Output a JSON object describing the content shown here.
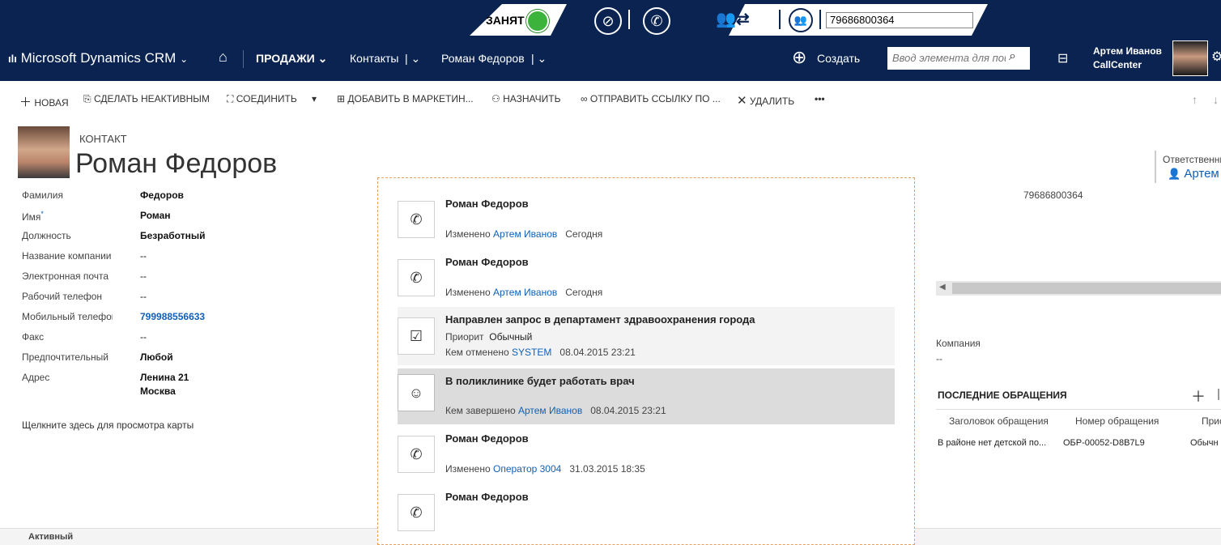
{
  "phonebar": {
    "status": "ЗАНЯТ",
    "phone_number": "79686800364",
    "icons": [
      "online-status-icon",
      "mute-icon",
      "hangup-icon",
      "transfer-icon",
      "conference-icon"
    ]
  },
  "nav": {
    "app_name": "Microsoft Dynamics CRM",
    "area": "ПРОДАЖИ",
    "entity": "Контакты",
    "record": "Роман Федоров",
    "create": "Создать",
    "search_placeholder": "Ввод элемента для поиска",
    "user_name": "Артем Иванов",
    "user_org": "CallCenter"
  },
  "commands": {
    "new": "НОВАЯ",
    "deactivate": "СДЕЛАТЬ НЕАКТИВНЫМ",
    "merge": "СОЕДИНИТЬ",
    "add_marketing": "ДОБАВИТЬ В МАРКЕТИН...",
    "assign": "НАЗНАЧИТЬ",
    "send_link": "ОТПРАВИТЬ ССЫЛКУ ПО ...",
    "delete": "УДАЛИТЬ",
    "more": "•••"
  },
  "header": {
    "entity_label": "КОНТАКТ",
    "name": "Роман Федоров",
    "owner_label": "Ответственный",
    "owner": "Артем"
  },
  "fields": [
    {
      "label": "Фамилия",
      "value": "Федоров"
    },
    {
      "label": "Имя",
      "value": "Роман"
    },
    {
      "label": "Должность",
      "value": "Безработный"
    },
    {
      "label": "Название компании",
      "value": "--"
    },
    {
      "label": "Электронная почта",
      "value": "--"
    },
    {
      "label": "Рабочий телефон",
      "value": "--"
    },
    {
      "label": "Мобильный телефон",
      "value": "799988556633"
    },
    {
      "label": "Факс",
      "value": "--"
    },
    {
      "label": "Предпочтительный",
      "value": "Любой"
    },
    {
      "label": "Адрес",
      "value": "Ленина 21",
      "value2": "Москва"
    }
  ],
  "map_link": "Щелкните здесь для просмотра карты",
  "activities": [
    {
      "title": "Роман Федоров",
      "prefix": "Изменено",
      "by": "Артем Иванов",
      "when": "Сегодня"
    },
    {
      "title": "Роман Федоров",
      "prefix": "Изменено",
      "by": "Артем Иванов",
      "when": "Сегодня"
    },
    {
      "title": "Направлен запрос в департамент здравоохранения города",
      "prio_label": "Приорит",
      "prio": "Обычный",
      "prefix": "Кем отменено",
      "by": "SYSTEM",
      "when": "08.04.2015 23:21"
    },
    {
      "title": "В поликлинике будет работать врач",
      "prefix": "Кем завершено",
      "by": "Артем Иванов",
      "when": "08.04.2015 23:21"
    },
    {
      "title": "Роман Федоров",
      "prefix": "Изменено",
      "by": "Оператор 3004",
      "when": "31.03.2015 18:35"
    },
    {
      "title": "Роман Федоров"
    }
  ],
  "right": {
    "phone": "79686800364",
    "company_label": "Компания",
    "company_value": "--",
    "recent_title": "ПОСЛЕДНИЕ ОБРАЩЕНИЯ",
    "columns": [
      "Заголовок обращения",
      "Номер обращения",
      "Приор"
    ],
    "row": [
      "В районе нет детской по...",
      "ОБР-00052-D8B7L9",
      "Обычн"
    ]
  },
  "footer_status": "Активный"
}
